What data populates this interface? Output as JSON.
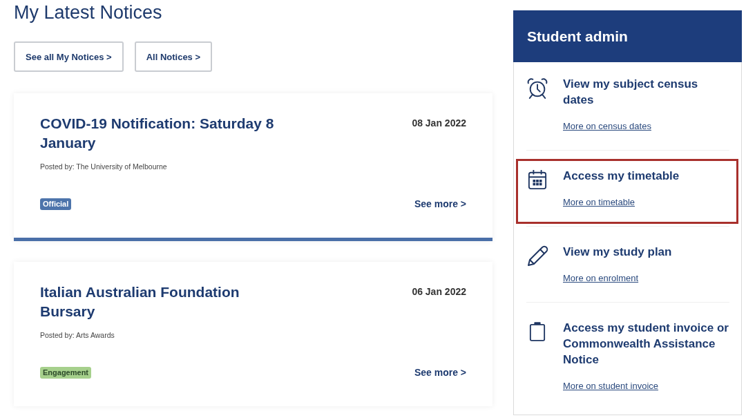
{
  "notices_header": {
    "title": "My Latest Notices",
    "buttons": [
      "See all My Notices >",
      "All Notices >"
    ]
  },
  "notices": [
    {
      "title": "COVID-19 Notification: Saturday 8 January",
      "date": "08 Jan 2022",
      "posted_by": "Posted by: The University of Melbourne",
      "tag": {
        "label": "Official",
        "color": "#4d74ab"
      },
      "link": "See more >",
      "accent_bar": true
    },
    {
      "title": "Italian Australian Foundation Bursary",
      "date": "06 Jan 2022",
      "posted_by": "Posted by: Arts Awards",
      "tag": {
        "label": "Engagement",
        "color": "#a6d08c"
      },
      "link": "See more >",
      "accent_bar": false
    }
  ],
  "student_admin": {
    "title": "Student admin",
    "items": [
      {
        "title": "View my subject census dates",
        "link": "More on census dates",
        "highlighted": false
      },
      {
        "title": "Access my timetable",
        "link": "More on timetable",
        "highlighted": true
      },
      {
        "title": "View my study plan",
        "link": "More on enrolment",
        "highlighted": false
      },
      {
        "title": "Access my student invoice or Commonwealth Assistance Notice",
        "link": "More on student invoice",
        "highlighted": false
      }
    ]
  }
}
